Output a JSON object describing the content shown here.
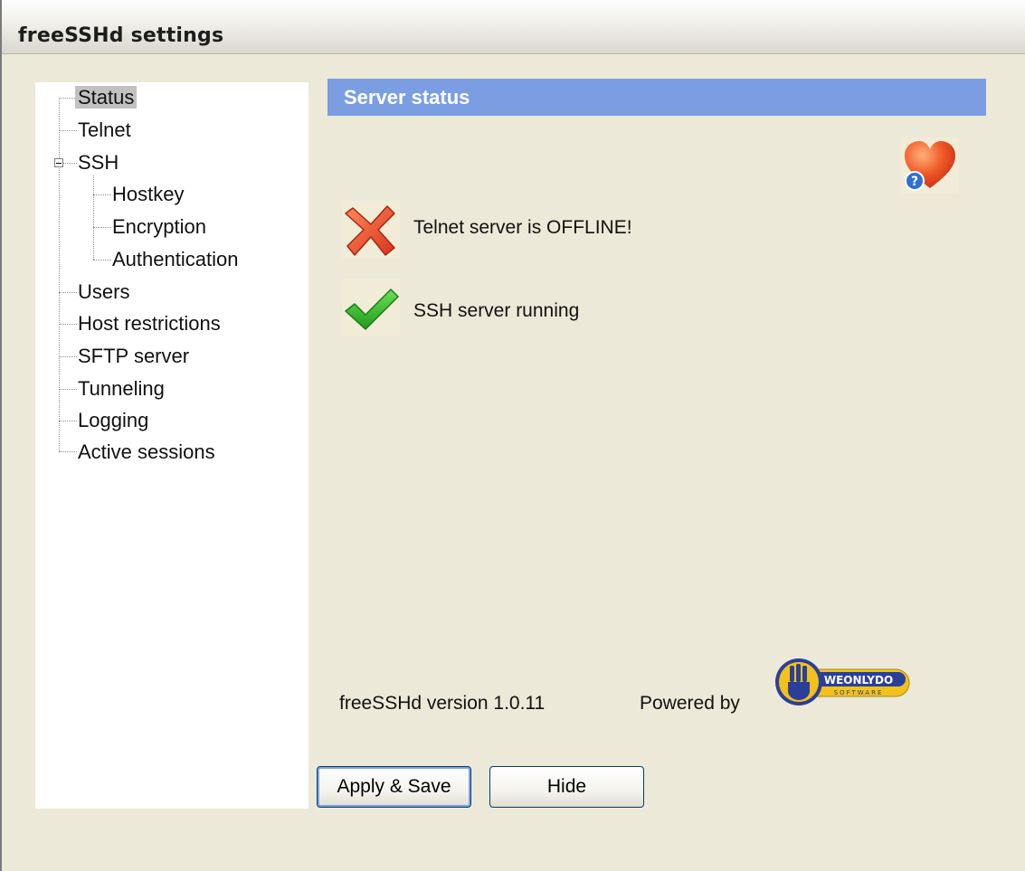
{
  "window": {
    "title": "freeSSHd settings"
  },
  "tree": {
    "items": [
      {
        "label": "Status",
        "selected": true
      },
      {
        "label": "Telnet"
      },
      {
        "label": "SSH",
        "expanded": true
      },
      {
        "label": "Hostkey"
      },
      {
        "label": "Encryption"
      },
      {
        "label": "Authentication"
      },
      {
        "label": "Users"
      },
      {
        "label": "Host restrictions"
      },
      {
        "label": "SFTP server"
      },
      {
        "label": "Tunneling"
      },
      {
        "label": "Logging"
      },
      {
        "label": "Active sessions"
      }
    ]
  },
  "panel": {
    "header": "Server status",
    "help_icon": "heart-help-icon",
    "telnet_status": {
      "icon": "red-x-icon",
      "text": "Telnet server is OFFLINE!"
    },
    "ssh_status": {
      "icon": "green-check-icon",
      "text": "SSH server running"
    },
    "version_text": "freeSSHd version 1.0.11",
    "powered_by": "Powered by",
    "logo": {
      "icon": "weonlydo-logo",
      "text": "WEONLYDO",
      "subtext": "SOFTWARE"
    }
  },
  "buttons": {
    "apply": "Apply & Save",
    "hide": "Hide"
  },
  "colors": {
    "header": "#7b9ee2",
    "window_bg": "#ece9d8",
    "selection": "#c1c1c1"
  }
}
